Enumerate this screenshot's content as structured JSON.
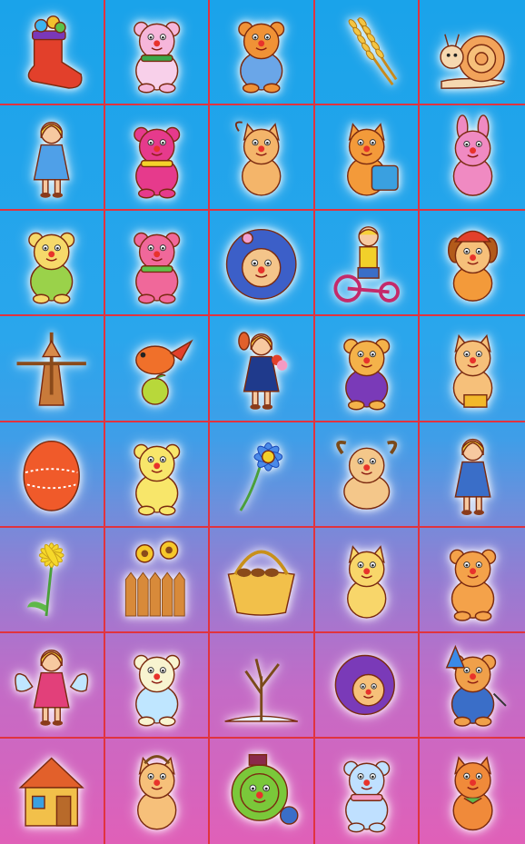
{
  "board": {
    "columns": 5,
    "rows": 8,
    "border_color": "#e0333f",
    "tiles": [
      {
        "icon": "candy-stocking-icon"
      },
      {
        "icon": "pink-bear-icon"
      },
      {
        "icon": "orange-bear-icon"
      },
      {
        "icon": "wheat-ears-icon"
      },
      {
        "icon": "snail-icon"
      },
      {
        "icon": "girl-icon"
      },
      {
        "icon": "magenta-bear-scarf-icon"
      },
      {
        "icon": "cow-icon"
      },
      {
        "icon": "cat-with-bag-icon"
      },
      {
        "icon": "pink-bunny-icon"
      },
      {
        "icon": "yellow-bear-icon"
      },
      {
        "icon": "pink-bear-scarf-icon"
      },
      {
        "icon": "hedgehog-icon"
      },
      {
        "icon": "boy-tricycle-icon"
      },
      {
        "icon": "dog-hat-icon"
      },
      {
        "icon": "windmill-icon"
      },
      {
        "icon": "bird-apple-icon"
      },
      {
        "icon": "schoolboy-flowers-icon"
      },
      {
        "icon": "bear-overalls-icon"
      },
      {
        "icon": "cow-bucket-icon"
      },
      {
        "icon": "painted-egg-icon"
      },
      {
        "icon": "yellow-bear-sitting-icon"
      },
      {
        "icon": "blue-flower-icon"
      },
      {
        "icon": "bull-icon"
      },
      {
        "icon": "sitting-girl-icon"
      },
      {
        "icon": "dandelion-icon"
      },
      {
        "icon": "sunflowers-fence-icon"
      },
      {
        "icon": "mushroom-basket-icon"
      },
      {
        "icon": "yellow-cat-icon"
      },
      {
        "icon": "orange-bear-big-icon"
      },
      {
        "icon": "angel-girl-icon"
      },
      {
        "icon": "white-bear-icon"
      },
      {
        "icon": "winter-tree-icon"
      },
      {
        "icon": "hedgehog-eating-icon"
      },
      {
        "icon": "bear-wand-icon"
      },
      {
        "icon": "house-icon"
      },
      {
        "icon": "calf-icon"
      },
      {
        "icon": "clown-ball-icon"
      },
      {
        "icon": "blue-bear-icon"
      },
      {
        "icon": "orange-cat-icon"
      }
    ]
  }
}
